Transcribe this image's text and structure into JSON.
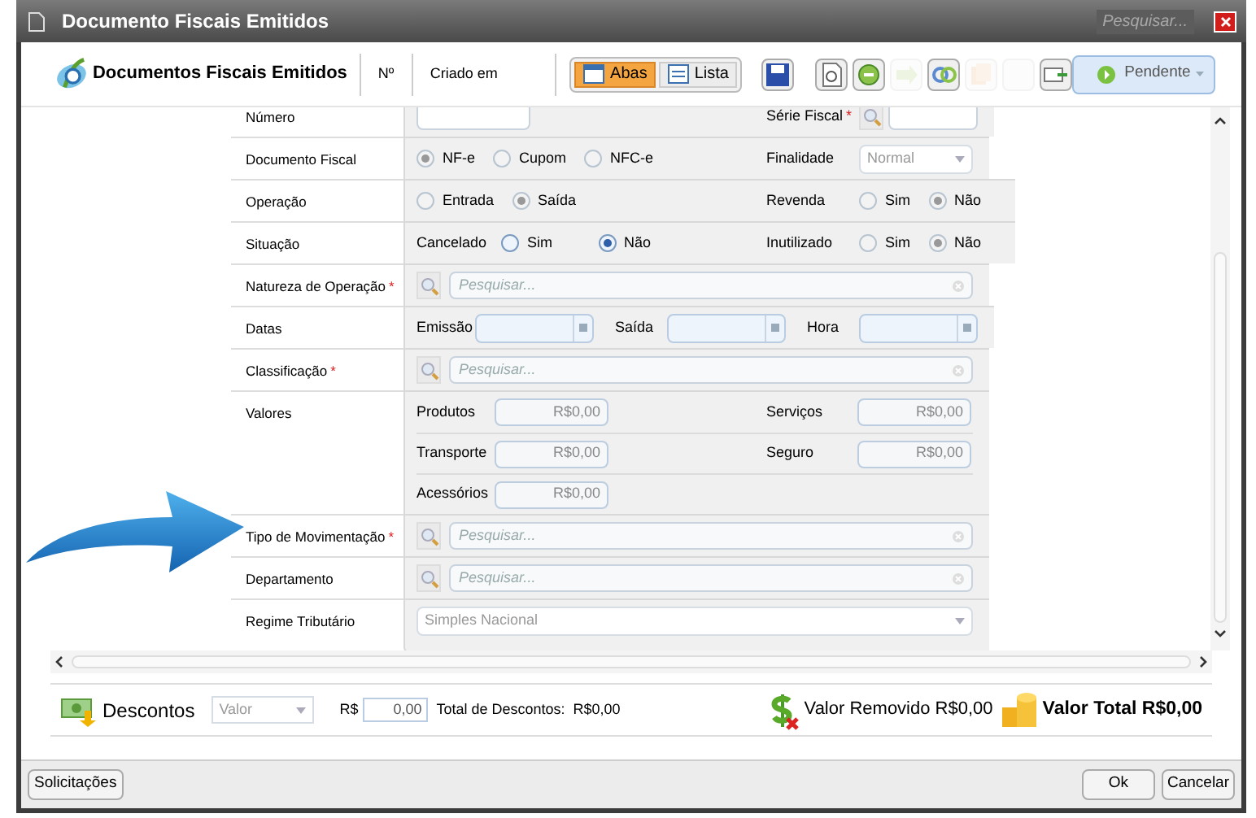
{
  "window": {
    "title": "Documento Fiscais Emitidos",
    "search_placeholder": "Pesquisar..."
  },
  "header": {
    "title": "Documentos Fiscais Emitidos",
    "columns": [
      "Nº",
      "Criado em"
    ],
    "view_tabs": [
      {
        "label": "Abas",
        "selected": true
      },
      {
        "label": "Lista",
        "selected": false
      }
    ],
    "tools": [
      {
        "kind": "save",
        "disabled": false
      },
      {
        "kind": "preview",
        "disabled": false
      },
      {
        "kind": "sync",
        "disabled": false
      },
      {
        "kind": "export",
        "disabled": true
      },
      {
        "kind": "link",
        "disabled": false
      },
      {
        "kind": "copy",
        "disabled": true
      },
      {
        "kind": "blank",
        "disabled": true
      },
      {
        "kind": "mail",
        "disabled": false
      }
    ],
    "status_button": "Pendente"
  },
  "form": [
    {
      "label": "Número",
      "left": {
        "kind": "text"
      },
      "right": {
        "label": "Série Fiscal",
        "marker": "*",
        "control": {
          "kind": "lookup_small"
        }
      }
    },
    {
      "label": "Documento Fiscal",
      "left": {
        "kind": "radios",
        "disabled": true,
        "options": [
          {
            "label": "NF-e",
            "selected": true
          },
          {
            "label": "Cupom",
            "selected": false
          },
          {
            "label": "NFC-e",
            "selected": false
          }
        ]
      },
      "right": {
        "label": "Finalidade",
        "control": {
          "kind": "select",
          "value": "Normal"
        }
      }
    },
    {
      "label": "Operação",
      "left": {
        "kind": "radios",
        "disabled": true,
        "options": [
          {
            "label": "Entrada",
            "selected": false
          },
          {
            "label": "Saída",
            "selected": true
          }
        ]
      },
      "right": {
        "label": "Revenda",
        "control": {
          "kind": "radios",
          "disabled": true,
          "options": [
            {
              "label": "Sim",
              "selected": false
            },
            {
              "label": "Não",
              "selected": true
            }
          ]
        }
      }
    },
    {
      "label": "Situação",
      "left": {
        "kind": "radios",
        "prefix": "Cancelado",
        "disabled": false,
        "options": [
          {
            "label": "Sim",
            "selected": false
          },
          {
            "label": "Não",
            "selected": true
          }
        ]
      },
      "right": {
        "label": "Inutilizado",
        "control": {
          "kind": "radios",
          "disabled": true,
          "options": [
            {
              "label": "Sim",
              "selected": false
            },
            {
              "label": "Não",
              "selected": true
            }
          ]
        }
      }
    },
    {
      "label": "Natureza de Operação",
      "marker": "*",
      "left": {
        "kind": "lookup",
        "placeholder": "Pesquisar..."
      }
    },
    {
      "label": "Datas",
      "left": {
        "kind": "dates",
        "fields": [
          "Emissão",
          "Saída",
          "Hora"
        ]
      }
    },
    {
      "label": "Classificação",
      "marker": "*",
      "left": {
        "kind": "lookup",
        "placeholder": "Pesquisar..."
      }
    },
    {
      "label": "Valores",
      "left": {
        "kind": "values",
        "fields": [
          {
            "label": "Produtos",
            "value": "R$0,00"
          },
          {
            "label": "Serviços",
            "value": "R$0,00"
          },
          {
            "label": "Transporte",
            "value": "R$0,00"
          },
          {
            "label": "Seguro",
            "value": "R$0,00"
          },
          {
            "label": "Acessórios",
            "value": "R$0,00"
          }
        ]
      }
    },
    {
      "label": "Tipo de Movimentação",
      "marker": "*",
      "left": {
        "kind": "lookup",
        "placeholder": "Pesquisar..."
      }
    },
    {
      "label": "Departamento",
      "left": {
        "kind": "lookup",
        "placeholder": "Pesquisar..."
      }
    },
    {
      "label": "Regime Tributário",
      "left": {
        "kind": "select",
        "value": "Simples Nacional"
      }
    }
  ],
  "totals": {
    "discount_label": "Descontos",
    "discount_type": "Valor",
    "currency": "R$",
    "discount_value": "0,00",
    "total_discounts_label": "Total de Descontos:",
    "total_discounts": "R$0,00",
    "removed": "Valor Removido R$0,00",
    "total": "Valor Total R$0,00"
  },
  "footer": {
    "left_button": "Solicitações",
    "buttons": [
      "Ok",
      "Cancelar"
    ]
  }
}
